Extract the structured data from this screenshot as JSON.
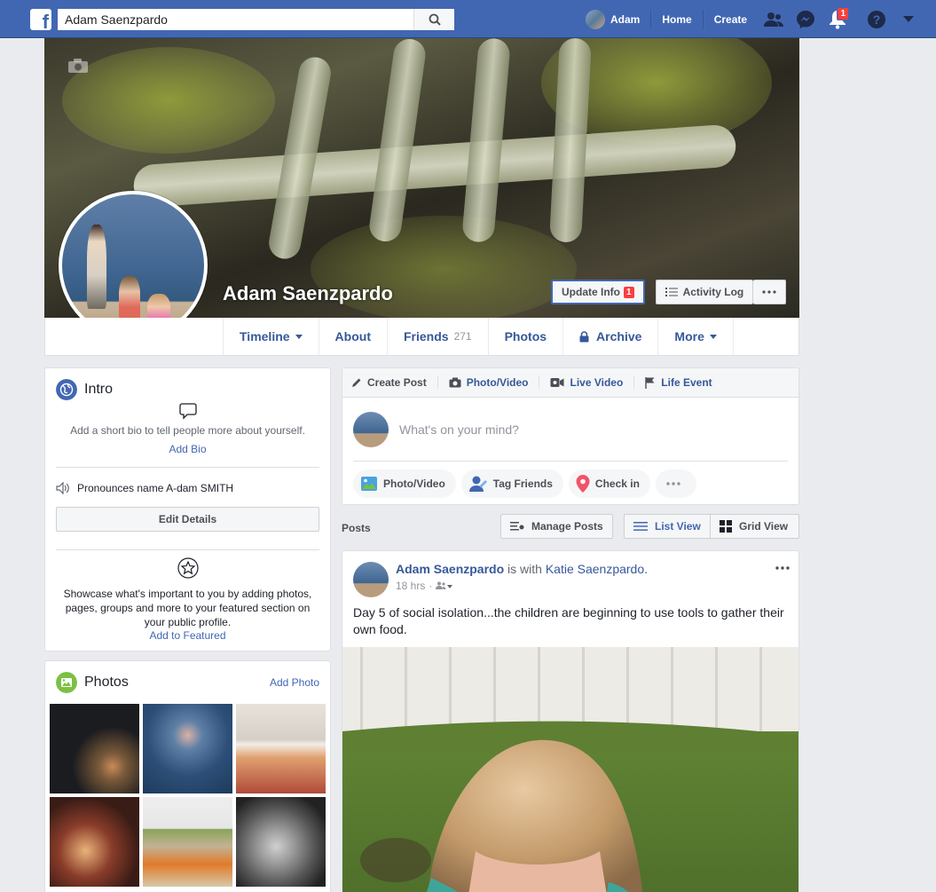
{
  "topbar": {
    "search_value": "Adam Saenzpardo",
    "user_name": "Adam",
    "home_label": "Home",
    "create_label": "Create",
    "notifications_count": "1"
  },
  "profile": {
    "name": "Adam Saenzpardo",
    "update_info_label": "Update Info",
    "update_info_badge": "1",
    "activity_log_label": "Activity Log"
  },
  "tabs": {
    "timeline": "Timeline",
    "about": "About",
    "friends": "Friends",
    "friends_count": "271",
    "photos": "Photos",
    "archive": "Archive",
    "more": "More"
  },
  "intro": {
    "title": "Intro",
    "bio_prompt": "Add a short bio to tell people more about yourself.",
    "add_bio": "Add Bio",
    "pronounces": "Pronounces name A-dam SMITH",
    "edit_details": "Edit Details",
    "featured_prompt": "Showcase what's important to you by adding photos, pages, groups and more to your featured section on your public profile.",
    "add_featured": "Add to Featured"
  },
  "photos_card": {
    "title": "Photos",
    "add_photo": "Add Photo"
  },
  "composer": {
    "tab_create_post": "Create Post",
    "tab_photo_video": "Photo/Video",
    "tab_live_video": "Live Video",
    "tab_life_event": "Life Event",
    "placeholder": "What's on your mind?",
    "pill_photo_video": "Photo/Video",
    "pill_tag_friends": "Tag Friends",
    "pill_check_in": "Check in"
  },
  "posts_bar": {
    "label": "Posts",
    "manage_posts": "Manage Posts",
    "list_view": "List View",
    "grid_view": "Grid View"
  },
  "post": {
    "author": "Adam Saenzpardo",
    "is_with": "is with",
    "tagged": "Katie Saenzpardo.",
    "time": "18 hrs",
    "text": "Day 5 of social isolation...the children are beginning to use tools to gather their own food."
  },
  "colors": {
    "fb_blue": "#4267b2",
    "link_blue": "#365899",
    "badge_red": "#fa3e3e",
    "page_bg": "#e9ebee"
  }
}
